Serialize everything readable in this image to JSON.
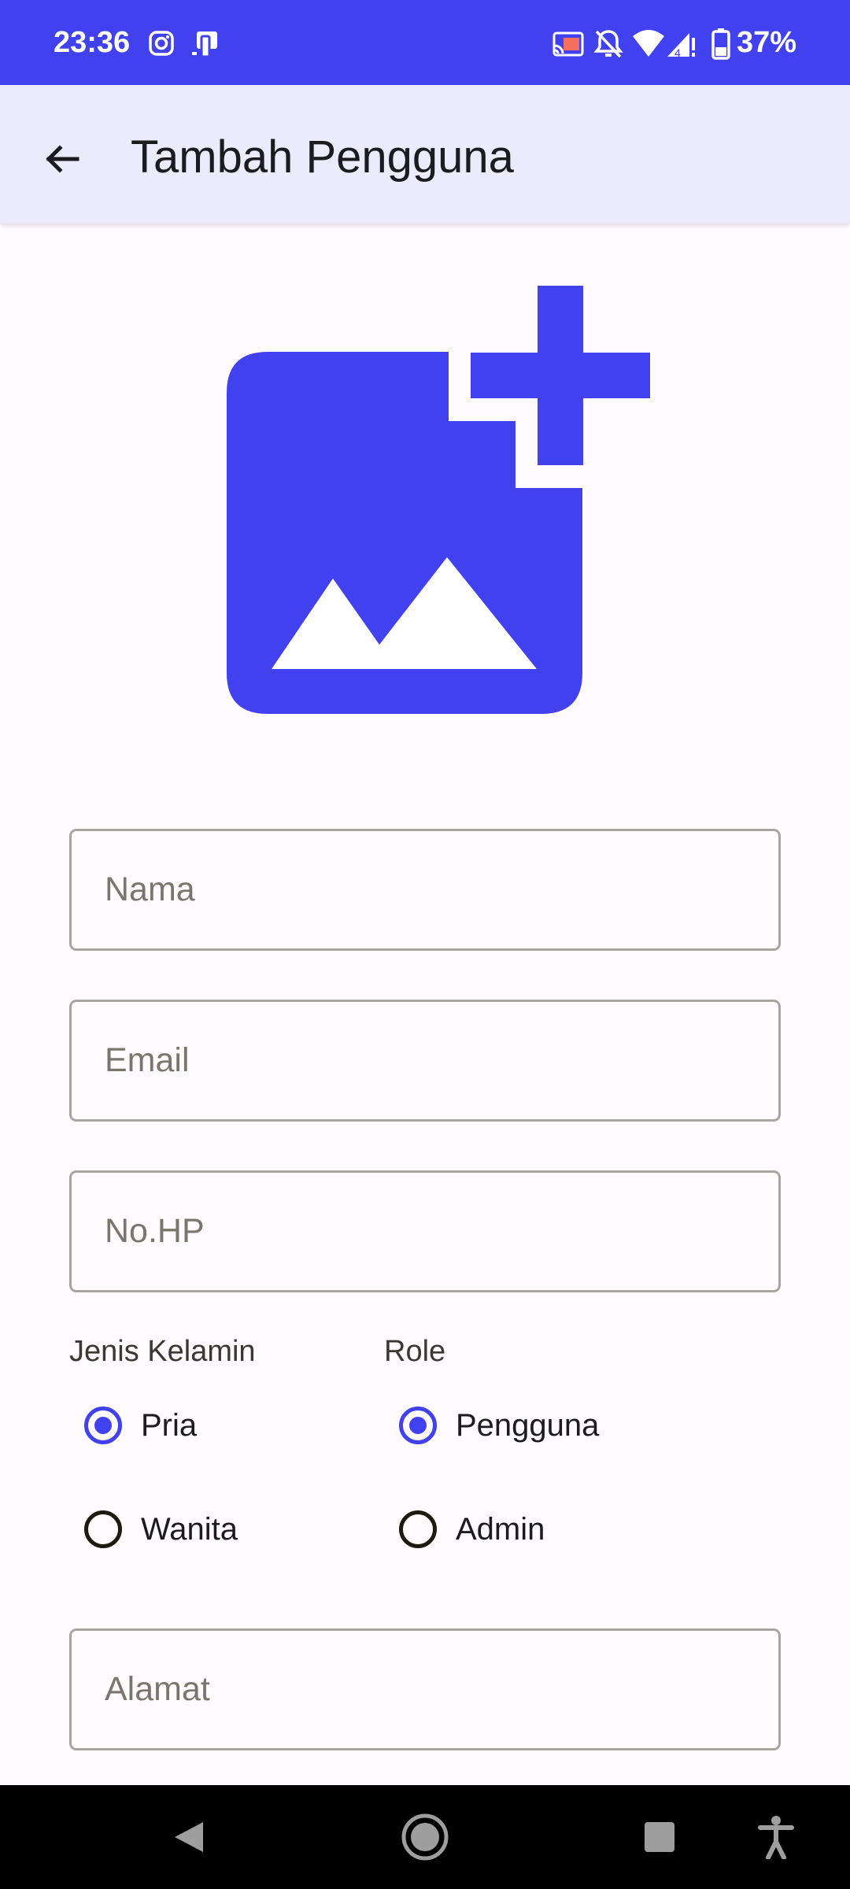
{
  "status_bar": {
    "time": "23:36",
    "battery": "37%",
    "icons": [
      "instagram-icon",
      "device-icon",
      "cast-icon",
      "bell-off-icon",
      "wifi-icon",
      "signal-icon",
      "battery-icon"
    ]
  },
  "app_bar": {
    "title": "Tambah Pengguna",
    "back_icon": "arrow-back-icon"
  },
  "image_picker": {
    "icon": "add-photo-icon",
    "color": "#4141F0"
  },
  "form": {
    "nama": {
      "placeholder": "Nama",
      "value": ""
    },
    "email": {
      "placeholder": "Email",
      "value": ""
    },
    "no_hp": {
      "placeholder": "No.HP",
      "value": ""
    },
    "alamat": {
      "placeholder": "Alamat",
      "value": ""
    },
    "jenis_kelamin": {
      "label": "Jenis Kelamin",
      "options": [
        "Pria",
        "Wanita"
      ],
      "selected": "Pria"
    },
    "role": {
      "label": "Role",
      "options": [
        "Pengguna",
        "Admin"
      ],
      "selected": "Pengguna"
    }
  },
  "nav_bar": {
    "icons": [
      "back-nav-icon",
      "home-nav-icon",
      "recents-nav-icon",
      "accessibility-icon"
    ]
  },
  "colors": {
    "accent": "#4141F0",
    "app_bar_bg": "#ECEBFC",
    "background": "#FFFBFE"
  }
}
